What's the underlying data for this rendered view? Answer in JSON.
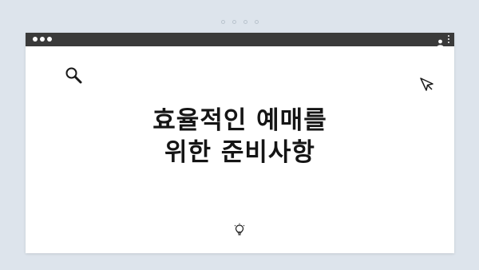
{
  "page_indicator": {
    "dot_count": 4
  },
  "window": {
    "titlebar_color": "#3a3a3a",
    "titlebar_icons": [
      "user-icon",
      "kebab-menu-icon"
    ]
  },
  "content": {
    "headline_line1": "효율적인 예매를",
    "headline_line2": "위한 준비사항",
    "icons": [
      "search-icon",
      "cursor-icon",
      "lightbulb-icon"
    ]
  },
  "colors": {
    "background": "#dde4ec",
    "card": "#ffffff",
    "text": "#151515"
  }
}
